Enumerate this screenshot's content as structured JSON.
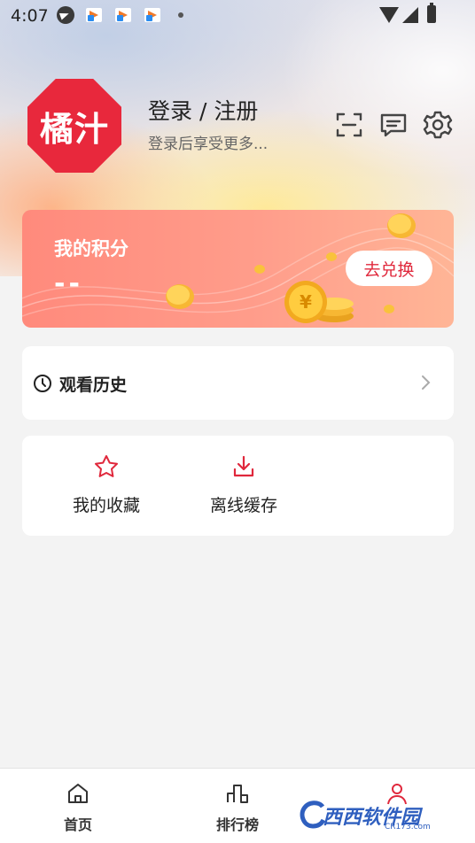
{
  "status_bar": {
    "time": "4:07"
  },
  "profile": {
    "logo_text": "橘汁",
    "login_title": "登录 / 注册",
    "login_subtitle": "登录后享受更多..."
  },
  "top_icons": [
    "scan-icon",
    "message-icon",
    "settings-icon"
  ],
  "points_card": {
    "title": "我的积分",
    "value": "--",
    "redeem_button": "去兑换"
  },
  "history": {
    "label": "观看历史"
  },
  "quick_actions": [
    {
      "label": "我的收藏",
      "icon": "star-icon"
    },
    {
      "label": "离线缓存",
      "icon": "download-icon"
    }
  ],
  "bottom_nav": [
    {
      "label": "首页",
      "icon": "home-icon"
    },
    {
      "label": "排行榜",
      "icon": "ranking-icon"
    },
    {
      "label": "",
      "icon": "profile-icon"
    }
  ],
  "watermark": {
    "text": "西西软件园",
    "small": "CR173.com"
  },
  "colors": {
    "brand_red": "#e8283c",
    "points_gradient_start": "#ff8a7c",
    "points_gradient_end": "#ffb596",
    "page_background": "#f3f3f3"
  }
}
